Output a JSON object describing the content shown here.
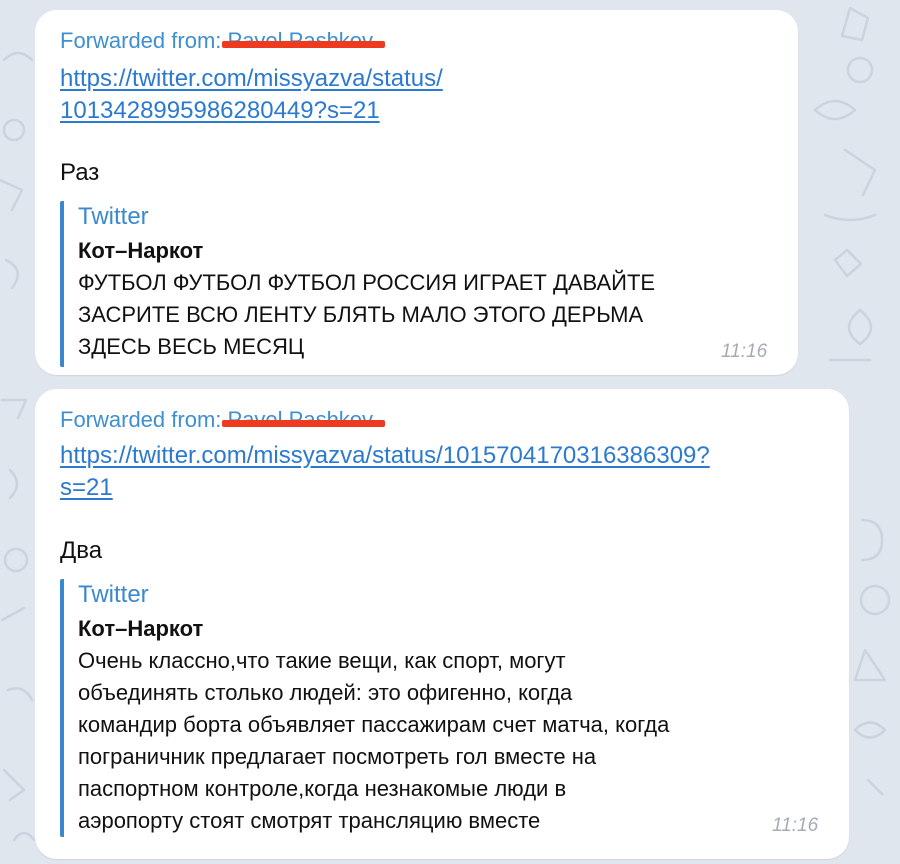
{
  "colors": {
    "background": "#dfe6ee",
    "bubble": "#ffffff",
    "accent": "#3e8fd0",
    "link": "#2b7ad0",
    "redaction": "#ee3a1e",
    "timestamp": "#a5acb3"
  },
  "messages": [
    {
      "forwarded_label": "Forwarded from:",
      "forwarded_name": "Pavel Pashkov",
      "link_lines": [
        "https://twitter.com/missyazva/status/",
        "1013428995986280449?s=21"
      ],
      "text": "Раз",
      "preview": {
        "site": "Twitter",
        "title": "Кот–Наркот",
        "body_lines": [
          "ФУТБОЛ ФУТБОЛ ФУТБОЛ РОССИЯ ИГРАЕТ ДАВАЙТЕ",
          "ЗАСРИТЕ ВСЮ ЛЕНТУ БЛЯТЬ МАЛО ЭТОГО ДЕРЬМА",
          "ЗДЕСЬ ВЕСЬ МЕСЯЦ"
        ]
      },
      "time": "11:16"
    },
    {
      "forwarded_label": "Forwarded from:",
      "forwarded_name": "Pavel Pashkov",
      "link_lines": [
        "https://twitter.com/missyazva/status/1015704170316386309?",
        "s=21"
      ],
      "text": "Два",
      "preview": {
        "site": "Twitter",
        "title": "Кот–Наркот",
        "body_lines": [
          "Очень классно,что такие вещи, как спорт, могут",
          "объединять столько людей: это офигенно, когда",
          "командир борта объявляет пассажирам счет матча, когда",
          "пограничник предлагает посмотреть гол вместе на",
          "паспортном контроле,когда незнакомые люди в",
          "аэропорту стоят смотрят трансляцию вместе"
        ]
      },
      "time": "11:16"
    }
  ]
}
